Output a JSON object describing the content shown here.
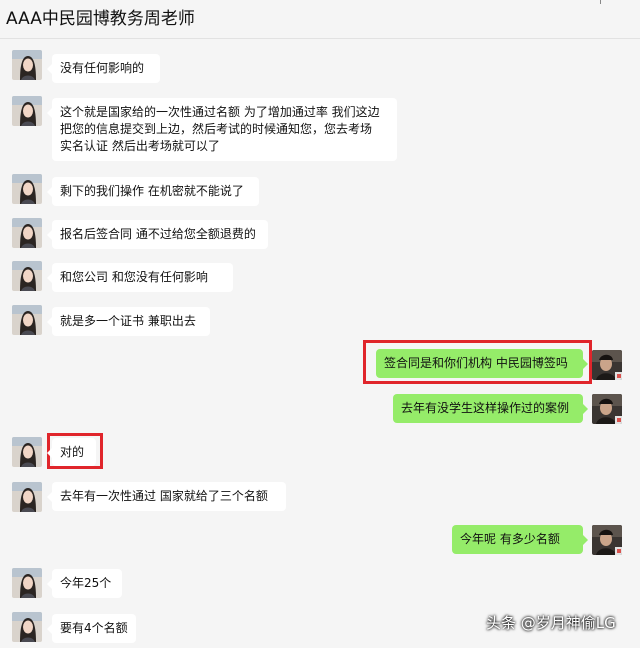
{
  "header": {
    "title": "AAA中民园博教务周老师"
  },
  "messages": [
    {
      "side": "left",
      "text": "没有任何影响的"
    },
    {
      "side": "left",
      "lines": [
        "这个就是国家给的一次性通过名额 为了增加通过率  我们这边",
        "把您的信息提交到上边，然后考试的时候通知您，您去考场",
        "实名认证 然后出考场就可以了"
      ]
    },
    {
      "side": "left",
      "text": "剩下的我们操作 在机密就不能说了"
    },
    {
      "side": "left",
      "text": "报名后签合同 通不过给您全额退费的"
    },
    {
      "side": "left",
      "text": "和您公司  和您没有任何影响"
    },
    {
      "side": "left",
      "text": "就是多一个证书  兼职出去"
    },
    {
      "side": "right",
      "text": "签合同是和你们机构 中民园博签吗",
      "highlighted": true
    },
    {
      "side": "right",
      "text": "去年有没学生这样操作过的案例"
    },
    {
      "side": "left",
      "text": "对的",
      "highlighted": true
    },
    {
      "side": "left",
      "text": "去年有一次性通过  国家就给了三个名额"
    },
    {
      "side": "right",
      "text": "今年呢  有多少名额"
    },
    {
      "side": "left",
      "text": "今年25个"
    },
    {
      "side": "left",
      "text": "要有4个名额"
    }
  ],
  "watermark": "头条 @岁月神偷LG",
  "colors": {
    "sent_bubble": "#95ec69",
    "received_bubble": "#ffffff",
    "highlight_box": "#e0252b",
    "background": "#f5f5f5"
  },
  "icons": {
    "received_avatar": "woman-portrait-avatar",
    "sent_avatar": "dark-portrait-avatar"
  }
}
